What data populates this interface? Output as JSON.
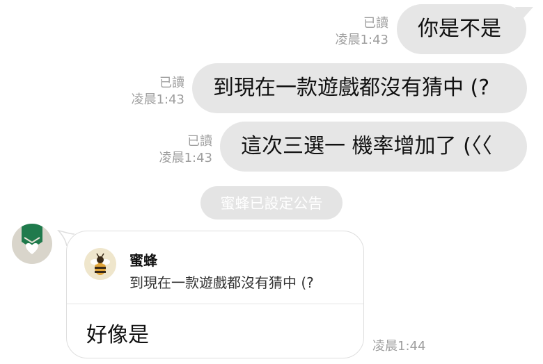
{
  "messages": [
    {
      "read": "已讀",
      "time": "凌晨1:43",
      "text": "你是不是"
    },
    {
      "read": "已讀",
      "time": "凌晨1:43",
      "text": "到現在一款遊戲都沒有猜中 (?"
    },
    {
      "read": "已讀",
      "time": "凌晨1:43",
      "text": "這次三選一 機率增加了 (〈〈"
    }
  ],
  "notice": "蜜蜂已設定公告",
  "reply": {
    "quoted_name": "蜜蜂",
    "quoted_text": "到現在一款遊戲都沒有猜中 (?",
    "text": "好像是",
    "time": "凌晨1:44"
  },
  "colors": {
    "sent_bubble": "#e6e6e6",
    "meta_text": "#9e9e9e",
    "avatar_green": "#1f7a4c",
    "bee_yellow": "#e0a53a"
  },
  "icons": {
    "sender_avatar": "green-ribbon-heart-avatar",
    "quoted_avatar": "bee-avatar"
  }
}
